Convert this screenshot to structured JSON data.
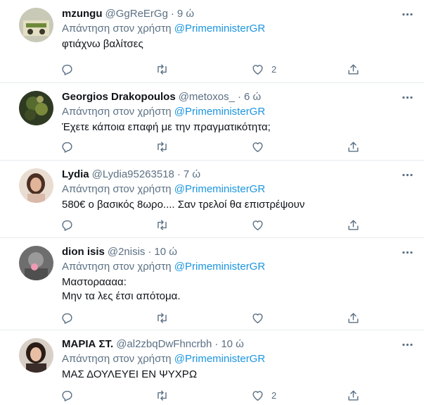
{
  "tweets": [
    {
      "name": "mzungu",
      "handle": "@GgReErGg",
      "time": "9 ώ",
      "reply_prefix": "Απάντηση στον χρήστη",
      "mention": "@PrimeministerGR",
      "lines": [
        "φτιάχνω βαλίτσες"
      ],
      "likes": "2"
    },
    {
      "name": "Georgios Drakopoulos",
      "handle": "@metoxos_",
      "time": "6 ώ",
      "reply_prefix": "Απάντηση στον χρήστη",
      "mention": "@PrimeministerGR",
      "lines": [
        "Έχετε κάποια επαφή με την πραγματικότητα;"
      ],
      "likes": ""
    },
    {
      "name": "Lydia",
      "handle": "@Lydia95263518",
      "time": "7 ώ",
      "reply_prefix": "Απάντηση στον χρήστη",
      "mention": "@PrimeministerGR",
      "lines": [
        "580€ ο βασικός 8ωρο.... Σαν τρελοί θα επιστρέψουν"
      ],
      "likes": ""
    },
    {
      "name": "dion isis",
      "handle": "@2nisis",
      "time": "10 ώ",
      "reply_prefix": "Απάντηση στον χρήστη",
      "mention": "@PrimeministerGR",
      "lines": [
        "Μαστοραααα:",
        "Μην τα λες έτσι απότομα."
      ],
      "likes": ""
    },
    {
      "name": "ΜΑΡΙΑ ΣΤ.",
      "handle": "@al2zbqDwFhncrbh",
      "time": "10 ώ",
      "reply_prefix": "Απάντηση στον χρήστη",
      "mention": "@PrimeministerGR",
      "lines": [
        "ΜΑΣ ΔΟΥΛΕΥΕΙ ΕΝ ΨΥΧΡΩ"
      ],
      "likes": "2"
    }
  ],
  "colors": {
    "accent": "#1b95e0",
    "secondary_text": "#5b7083",
    "divider": "#e6ecf0"
  }
}
